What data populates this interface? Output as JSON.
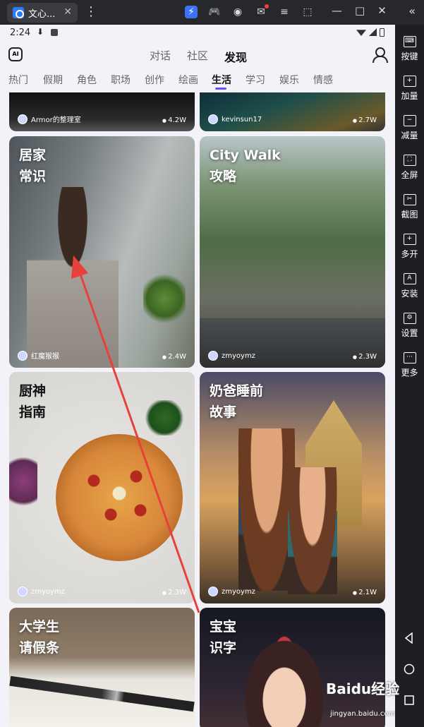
{
  "window": {
    "tab_title": "文心...",
    "tab_close": "✕",
    "kebab": "⋮",
    "collapse": "«",
    "controls": [
      "—",
      "□",
      "✕"
    ]
  },
  "status_bar": {
    "time": "2:24"
  },
  "top_nav": {
    "tabs": [
      "对话",
      "社区",
      "发现"
    ],
    "active": "发现"
  },
  "categories": {
    "items": [
      "热门",
      "假期",
      "角色",
      "职场",
      "创作",
      "绘画",
      "生活",
      "学习",
      "娱乐",
      "情感"
    ],
    "active": "生活"
  },
  "cards": [
    {
      "title": "",
      "author": "Armor的整理室",
      "views": "4.2W"
    },
    {
      "title": "",
      "author": "kevinsun17",
      "views": "2.7W"
    },
    {
      "title_lines": [
        "居家",
        "常识"
      ],
      "author": "红魔猴猴",
      "views": "2.4W"
    },
    {
      "title_lines": [
        "City Walk",
        "攻略"
      ],
      "author": "zmyoymz",
      "views": "2.3W"
    },
    {
      "title_lines": [
        "厨神",
        "指南"
      ],
      "author": "zmyoymz",
      "views": "2.3W"
    },
    {
      "title_lines": [
        "奶爸睡前",
        "故事"
      ],
      "author": "zmyoymz",
      "views": "2.1W"
    },
    {
      "title_lines": [
        "大学生",
        "请假条"
      ]
    },
    {
      "title_lines": [
        "宝宝",
        "识字"
      ]
    }
  ],
  "sidebar": {
    "items": [
      "按键",
      "加量",
      "减量",
      "全屏",
      "截图",
      "多开",
      "安装",
      "设置",
      "更多"
    ]
  },
  "watermark": {
    "brand": "Baidu经验",
    "url": "jingyan.baidu.com"
  },
  "colors": {
    "accent": "#6a4ef5",
    "annotation_arrow": "#e8403a"
  }
}
